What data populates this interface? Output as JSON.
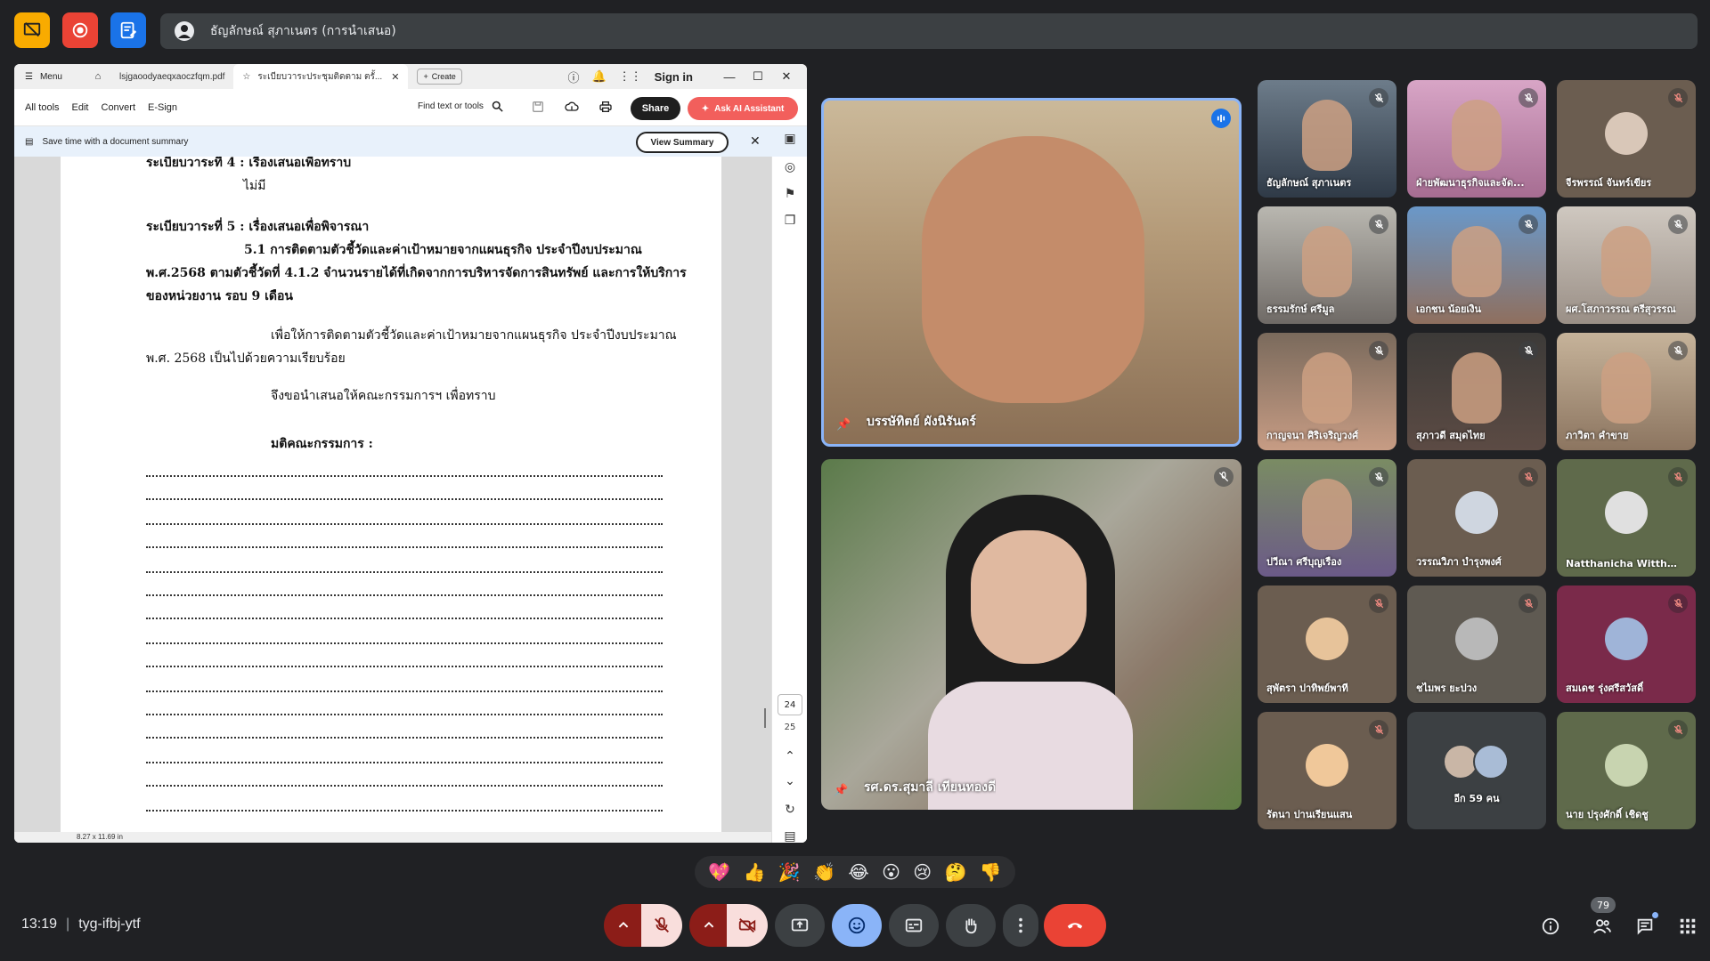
{
  "presenter_bar": {
    "text": "ธัญลักษณ์ สุภาเนตร (การนำเสนอ)"
  },
  "acrobat": {
    "menu_label": "Menu",
    "tabs": [
      {
        "label": "lsjgaoodyaeqxaoczfqm.pdf",
        "active": false
      },
      {
        "label": "ระเบียบวาระประชุมติดตาม ตรั้...",
        "active": true
      }
    ],
    "create_label": "Create",
    "sign_in": "Sign in",
    "toolbar": {
      "all_tools": "All tools",
      "edit": "Edit",
      "convert": "Convert",
      "esign": "E-Sign",
      "find": "Find text or tools",
      "share": "Share",
      "ai": "Ask AI Assistant"
    },
    "summary": {
      "text": "Save time with a document summary",
      "button": "View Summary"
    },
    "page": {
      "l1": "ระเบียบวาระที่ 4 :  เรื่องเสนอเพื่อทราบ",
      "l2": "ไม่มี",
      "l3": "ระเบียบวาระที่ 5  :  เรื่องเสนอเพื่อพิจารณา",
      "l4": "5.1  การติดตามตัวชี้วัดและค่าเป้าหมายจากแผนธุรกิจ ประจำปีงบประมาณ",
      "l5": "พ.ศ.2568 ตามตัวชี้วัดที่ 4.1.2 จำนวนรายได้ที่เกิดจากการบริหารจัดการสินทรัพย์ และการให้บริการ",
      "l6": "ของหน่วยงาน รอบ 9 เดือน",
      "l7": "เพื่อให้การติดตามตัวชี้วัดและค่าเป้าหมายจากแผนธุรกิจ ประจำปีงบประมาณ",
      "l8": "พ.ศ. 2568 เป็นไปด้วยความเรียบร้อย",
      "l9": "จึงขอนำเสนอให้คณะกรรมการฯ เพื่อทราบ",
      "l10": "มติคณะกรรมการ :"
    },
    "page_current": "24",
    "page_total": "25",
    "page_size": "8.27 x 11.69 in"
  },
  "participants": {
    "speaker_main": "บรรษัทิตย์ ผังนิรันดร์",
    "speaker_second": "รศ.ดร.สุมาลี เทียนทองดี",
    "grid": [
      "ธัญลักษณ์ สุภาเนตร",
      "ฝ่ายพัฒนาธุรกิจและจัด...",
      "จีรพรรณ์ จันทร์เขียร",
      "ธรรมรักษ์ ศรีมูล",
      "เอกชน น้อยเงิน",
      "ผศ.โสภาวรรณ ตรีสุวรรณ",
      "กาญจนา ศิริเจริญวงศ์",
      "สุภาวดี สมุดไทย",
      "ภาวิตา คำขาย",
      "ปวีณา ศรีบุญเรือง",
      "วรรณวิภา บำรุงพงศ์",
      "Natthanicha Wittha...",
      "สุพัตรา ปาทิพย์พาที",
      "ชไมพร ยะปวง",
      "สมเดช รุ่งศรีสวัสดิ์",
      "รัตนา ปานเรียนแสน",
      "อีก 59 คน",
      "นาย ปรุงศักดิ์ เชิดชู"
    ]
  },
  "reactions": [
    "💖",
    "👍",
    "🎉",
    "👏",
    "😂",
    "😮",
    "😢",
    "🤔",
    "👎"
  ],
  "meeting": {
    "time": "13:19",
    "code": "tyg-ifbj-ytf",
    "participants_count": "79"
  },
  "colors": {
    "bg": "#202124",
    "tile": "#3c4043",
    "accent_blue": "#8ab4f8",
    "end_red": "#ea4335",
    "speaking_border": "#8ab4f8"
  }
}
